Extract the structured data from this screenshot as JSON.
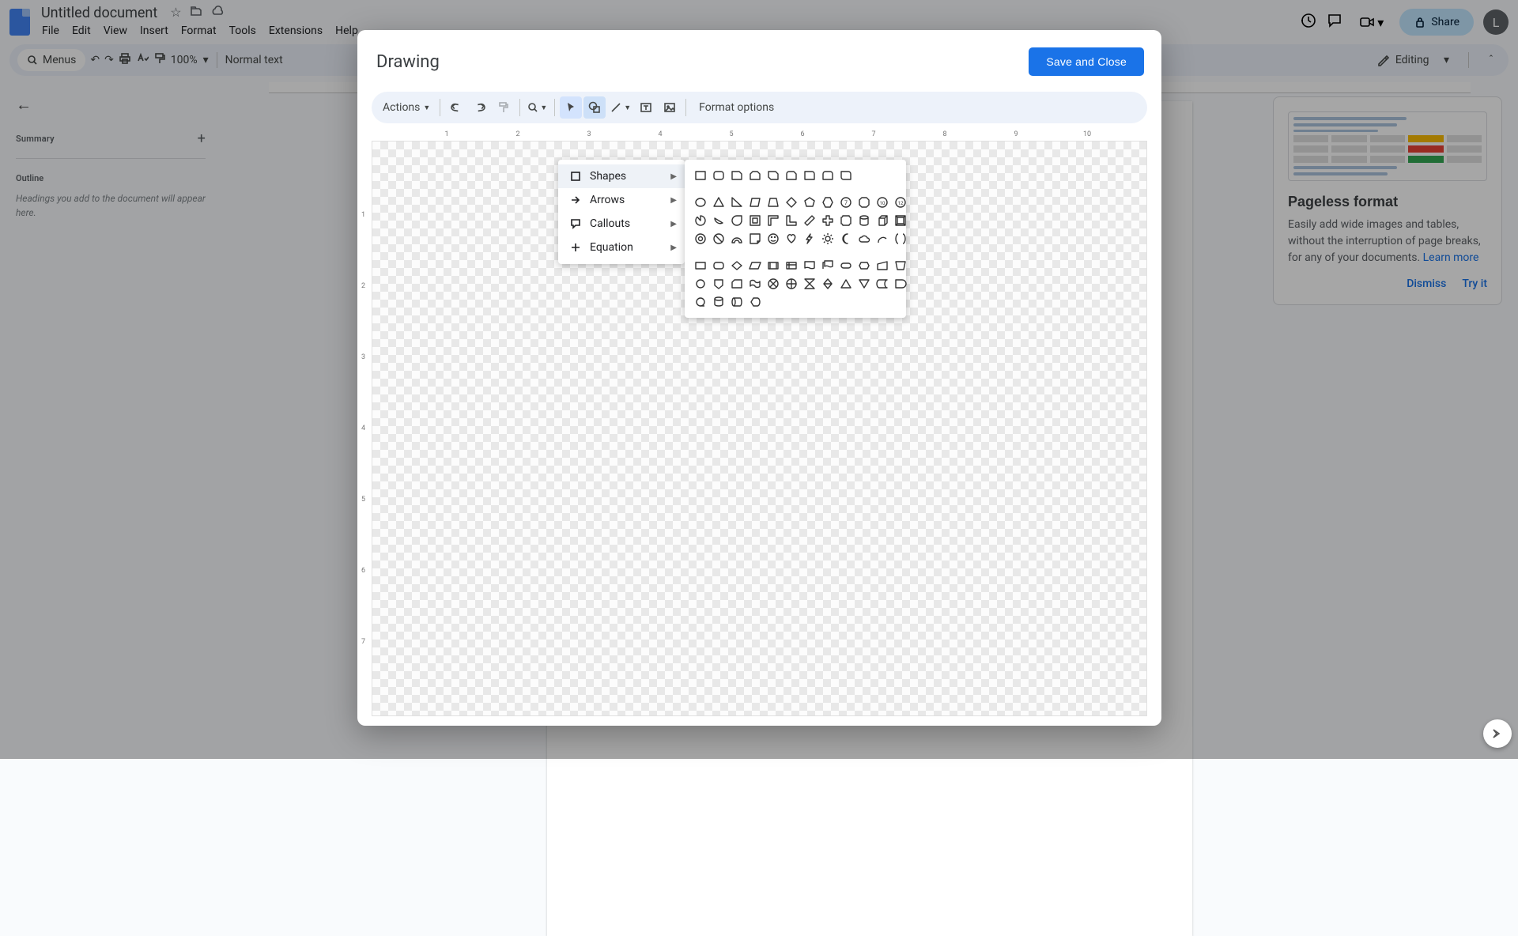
{
  "doc": {
    "title": "Untitled document"
  },
  "menubar": [
    "File",
    "Edit",
    "View",
    "Insert",
    "Format",
    "Tools",
    "Extensions",
    "Help"
  ],
  "header": {
    "share": "Share",
    "avatar_initial": "L"
  },
  "toolbar": {
    "menus_chip": "Menus",
    "zoom": "100%",
    "style": "Normal text",
    "editing": "Editing"
  },
  "left": {
    "summary": "Summary",
    "outline": "Outline",
    "outline_hint": "Headings you add to the document will appear here."
  },
  "promo": {
    "title": "Pageless format",
    "body_1": "Easily add wide images and tables, without the interruption of page breaks, for any of your documents.",
    "learn_more": "Learn more",
    "dismiss": "Dismiss",
    "try": "Try it"
  },
  "dialog": {
    "title": "Drawing",
    "save": "Save and Close",
    "actions": "Actions",
    "format_options": "Format options",
    "ruler_h": [
      "1",
      "2",
      "3",
      "4",
      "5",
      "6",
      "7",
      "8",
      "9",
      "10"
    ],
    "ruler_v": [
      "1",
      "2",
      "3",
      "4",
      "5",
      "6",
      "7"
    ]
  },
  "shape_menu": {
    "shapes": "Shapes",
    "arrows": "Arrows",
    "callouts": "Callouts",
    "equation": "Equation"
  }
}
